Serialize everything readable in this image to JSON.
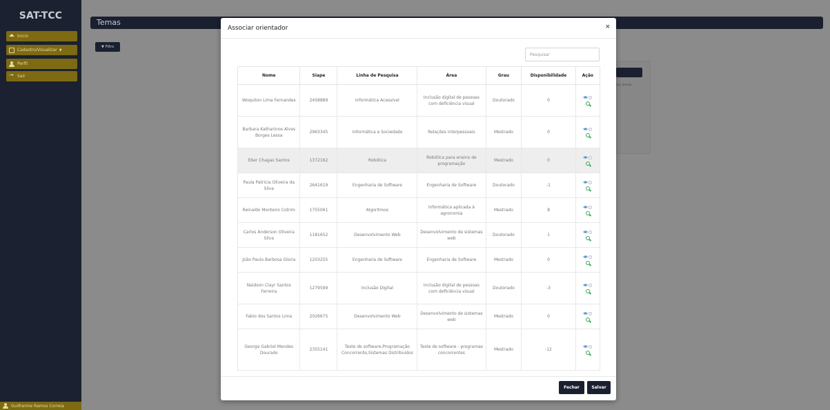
{
  "app": {
    "title": "SAT-TCC"
  },
  "sidebar": {
    "items": [
      {
        "label": "Inicio",
        "icon": "home-icon"
      },
      {
        "label": "Cadastro/Visualizar",
        "icon": "form-icon",
        "has_caret": true
      },
      {
        "label": "Perfil",
        "icon": "user-icon"
      },
      {
        "label": "Sair",
        "icon": "exit-icon"
      }
    ],
    "user": "Guilherme Ramos Correia"
  },
  "page": {
    "title": "Temas",
    "filter_label": "Filtro",
    "bg_card_text": "ma, almeja"
  },
  "modal": {
    "title": "Associar orientador",
    "close_label": "×",
    "search": {
      "placeholder": "Pesquisar",
      "value": ""
    },
    "columns": [
      "Nome",
      "Siape",
      "Linha de Pesquisa",
      "Área",
      "Grau",
      "Disponibilidade",
      "Ação"
    ],
    "rows": [
      {
        "nome": "Woquiton Lima Fernandes",
        "siape": "2458889",
        "linha": "Informática Acessível",
        "area": "Inclusão digital de pessoas com deficiência visual",
        "grau": "Doutorado",
        "disp": "0"
      },
      {
        "nome": "Barbara Katharinne Alves Borges Lessa",
        "siape": "2963345",
        "linha": "Informática e Sociedade",
        "area": "Relações interpessoais",
        "grau": "Mestrado",
        "disp": "0"
      },
      {
        "nome": "Eber Chagas Santos",
        "siape": "1372162",
        "linha": "Robótica",
        "area": "Robótica para ensino de programação",
        "grau": "Mestrado",
        "disp": "0"
      },
      {
        "nome": "Paula Patricia Oliveira da Silva",
        "siape": "2641619",
        "linha": "Engenharia de Software",
        "area": "Engenharia de Software",
        "grau": "Doutorado",
        "disp": "-1"
      },
      {
        "nome": "Reinaldo Monteiro Cotrim",
        "siape": "1755061",
        "linha": "Algoritmos",
        "area": "Informática aplicada à agronomia",
        "grau": "Mestrado",
        "disp": "8"
      },
      {
        "nome": "Carlos Anderson Oliveira Silva",
        "siape": "1181652",
        "linha": "Desenvolvimento Web",
        "area": "Desenvolvimento de sistemas web",
        "grau": "Doutorado",
        "disp": "1"
      },
      {
        "nome": "João Paulo Barbosa Gloria",
        "siape": "1203255",
        "linha": "Engenharia de Software",
        "area": "Engenharia de Software",
        "grau": "Mestrado",
        "disp": "0"
      },
      {
        "nome": "Naidson Clayr Santos Ferreira",
        "siape": "1279599",
        "linha": "Inclusão Digital",
        "area": "Inclusão digital de pessoas com deficiência visual",
        "grau": "Doutorado",
        "disp": "-3"
      },
      {
        "nome": "Fabio dos Santos Lima",
        "siape": "2026675",
        "linha": "Desenvolvimento Web",
        "area": "Desenvolvimento de sistemas web",
        "grau": "Mestrado",
        "disp": "0"
      },
      {
        "nome": "George Gabriel Mendes Dourado",
        "siape": "2355141",
        "linha": "Teste de software,Programação Concorrente,Sistemas Distribuidos",
        "area": "Teste de software - programas concorrentes",
        "grau": "Mestrado",
        "disp": "-12"
      }
    ],
    "highlighted_row": 2,
    "buttons": {
      "close": "Fechar",
      "save": "Salvar"
    }
  },
  "colors": {
    "sidebar_bg": "#1b2130",
    "sidebar_item": "#7d6a12",
    "header_dark": "#1a2030",
    "eye_blue": "#3f87d4",
    "zoom_green": "#2eab57"
  }
}
